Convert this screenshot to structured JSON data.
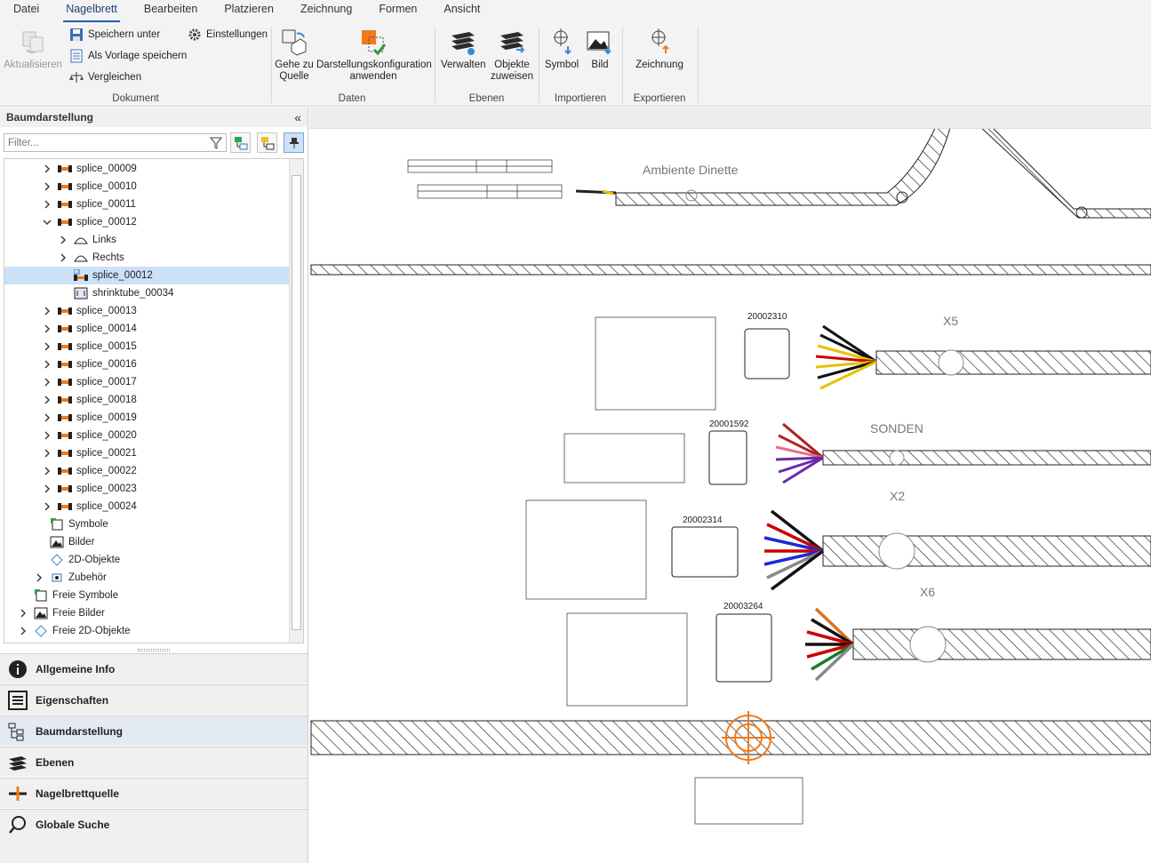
{
  "menu": [
    "Datei",
    "Nagelbrett",
    "Bearbeiten",
    "Platzieren",
    "Zeichnung",
    "Formen",
    "Ansicht"
  ],
  "ribbon": {
    "dokument": {
      "label": "Dokument",
      "aktualisieren": "Aktualisieren",
      "speichern_unter": "Speichern unter",
      "als_vorlage": "Als Vorlage speichern",
      "vergleichen": "Vergleichen",
      "einstellungen": "Einstellungen"
    },
    "daten": {
      "label": "Daten",
      "gehe_zu_1": "Gehe zu",
      "gehe_zu_2": "Quelle",
      "darst_1": "Darstellungskonfiguration",
      "darst_2": "anwenden"
    },
    "ebenen": {
      "label": "Ebenen",
      "verwalten": "Verwalten",
      "objekte_1": "Objekte",
      "objekte_2": "zuweisen"
    },
    "importieren": {
      "label": "Importieren",
      "symbol": "Symbol",
      "bild": "Bild"
    },
    "exportieren": {
      "label": "Exportieren",
      "zeichnung": "Zeichnung"
    }
  },
  "panel": {
    "title": "Baumdarstellung",
    "collapse": "«",
    "filter_placeholder": "Filter..."
  },
  "tree": [
    {
      "label": "splice_00009",
      "indent": 1,
      "exp": "right",
      "icon": "splice"
    },
    {
      "label": "splice_00010",
      "indent": 1,
      "exp": "right",
      "icon": "splice"
    },
    {
      "label": "splice_00011",
      "indent": 1,
      "exp": "right",
      "icon": "splice"
    },
    {
      "label": "splice_00012",
      "indent": 1,
      "exp": "down",
      "icon": "splice"
    },
    {
      "label": "Links",
      "indent": 2,
      "exp": "right",
      "icon": "side"
    },
    {
      "label": "Rechts",
      "indent": 2,
      "exp": "right",
      "icon": "side"
    },
    {
      "label": "splice_00012",
      "indent": 2,
      "exp": "none",
      "icon": "splice-sel",
      "selected": true
    },
    {
      "label": "shrinktube_00034",
      "indent": 2,
      "exp": "none",
      "icon": "tube"
    },
    {
      "label": "splice_00013",
      "indent": 1,
      "exp": "right",
      "icon": "splice"
    },
    {
      "label": "splice_00014",
      "indent": 1,
      "exp": "right",
      "icon": "splice"
    },
    {
      "label": "splice_00015",
      "indent": 1,
      "exp": "right",
      "icon": "splice"
    },
    {
      "label": "splice_00016",
      "indent": 1,
      "exp": "right",
      "icon": "splice"
    },
    {
      "label": "splice_00017",
      "indent": 1,
      "exp": "right",
      "icon": "splice"
    },
    {
      "label": "splice_00018",
      "indent": 1,
      "exp": "right",
      "icon": "splice"
    },
    {
      "label": "splice_00019",
      "indent": 1,
      "exp": "right",
      "icon": "splice"
    },
    {
      "label": "splice_00020",
      "indent": 1,
      "exp": "right",
      "icon": "splice"
    },
    {
      "label": "splice_00021",
      "indent": 1,
      "exp": "right",
      "icon": "splice"
    },
    {
      "label": "splice_00022",
      "indent": 1,
      "exp": "right",
      "icon": "splice"
    },
    {
      "label": "splice_00023",
      "indent": 1,
      "exp": "right",
      "icon": "splice"
    },
    {
      "label": "splice_00024",
      "indent": 1,
      "exp": "right",
      "icon": "splice"
    },
    {
      "label": "Symbole",
      "indent": 0.5,
      "exp": "none",
      "icon": "symbol"
    },
    {
      "label": "Bilder",
      "indent": 0.5,
      "exp": "none",
      "icon": "image"
    },
    {
      "label": "2D-Objekte",
      "indent": 0.5,
      "exp": "none",
      "icon": "2d"
    },
    {
      "label": "Zubehör",
      "indent": 0.5,
      "exp": "right",
      "icon": "acc"
    },
    {
      "label": "Freie Symbole",
      "indent": -0.5,
      "exp": "none",
      "icon": "symbol"
    },
    {
      "label": "Freie Bilder",
      "indent": -0.5,
      "exp": "right",
      "icon": "image"
    },
    {
      "label": "Freie 2D-Objekte",
      "indent": -0.5,
      "exp": "right",
      "icon": "2d"
    }
  ],
  "nav": [
    "Allgemeine Info",
    "Eigenschaften",
    "Baumdarstellung",
    "Ebenen",
    "Nagelbrettquelle",
    "Globale Suche"
  ],
  "drawing": {
    "ambiente": "Ambiente Dinette",
    "sonden": "SONDEN",
    "x5": "X5",
    "x2": "X2",
    "x6": "X6",
    "pn1": "20002310",
    "pn2": "20001592",
    "pn3": "20002314",
    "pn4": "20003264"
  }
}
